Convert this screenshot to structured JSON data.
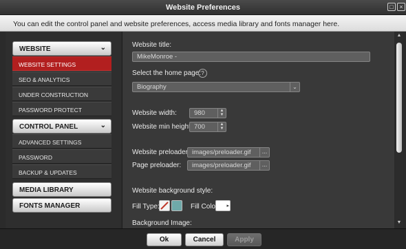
{
  "window": {
    "title": "Website Preferences"
  },
  "info": {
    "text": "You can edit the control panel and website preferences, access media library and fonts manager here."
  },
  "sidebar": {
    "website": {
      "label": "WEBSITE",
      "items": [
        "WEBSITE SETTINGS",
        "SEO & ANALYTICS",
        "UNDER CONSTRUCTION",
        "PASSWORD PROTECT"
      ]
    },
    "control_panel": {
      "label": "CONTROL PANEL",
      "items": [
        "ADVANCED SETTINGS",
        "PASSWORD",
        "BACKUP & UPDATES"
      ]
    },
    "media_library": {
      "label": "MEDIA LIBRARY"
    },
    "fonts_manager": {
      "label": "FONTS MANAGER"
    }
  },
  "form": {
    "website_title": {
      "label": "Website title:",
      "value": "MikeMonroe -"
    },
    "home_page": {
      "label": "Select the home page:",
      "value": "Biography"
    },
    "website_width": {
      "label": "Website width:",
      "value": "980"
    },
    "website_min_height": {
      "label": "Website min height:",
      "value": "700"
    },
    "website_preloader": {
      "label": "Website preloader:",
      "value": "images/preloader.gif"
    },
    "page_preloader": {
      "label": "Page preloader:",
      "value": "images/preloader.gif"
    },
    "background_style": {
      "label": "Website background style:"
    },
    "fill_type": {
      "label": "Fill Type:"
    },
    "fill_color": {
      "label": "Fill Color:",
      "value": "#ffffff"
    },
    "background_image": {
      "label": "Background Image:"
    }
  },
  "footer": {
    "ok": "Ok",
    "cancel": "Cancel",
    "apply": "Apply"
  }
}
